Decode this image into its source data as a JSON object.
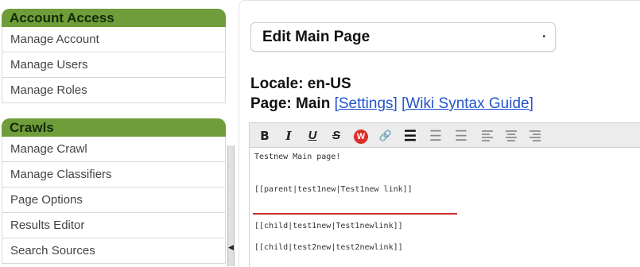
{
  "sidebar": {
    "sections": [
      {
        "title": "Account Access",
        "items": [
          "Manage Account",
          "Manage Users",
          "Manage Roles"
        ]
      },
      {
        "title": "Crawls",
        "items": [
          "Manage Crawl",
          "Manage Classifiers",
          "Page Options",
          "Results Editor",
          "Search Sources"
        ]
      }
    ]
  },
  "main": {
    "page_select": "Edit Main Page",
    "locale": "Locale: en-US",
    "page_label": "Page: Main",
    "settings_link": "[Settings]",
    "wiki_link": "[Wiki Syntax Guide]",
    "toolbar": {
      "bold": "B",
      "italic": "I",
      "underline": "U",
      "strike": "S",
      "wiki": "W",
      "link": "🔗",
      "bullets": "☰",
      "numbered": "☰",
      "indent": "☰"
    },
    "editor_lines": [
      "Testnew Main page!",
      "[[parent|test1new|Test1new link]]",
      "[[child|test1new|Test1newlink]]",
      "[[child|test2new|test2newlink]]"
    ]
  },
  "colors": {
    "section_header": "#6f9d3a",
    "link": "#2255cc",
    "annotation_underline": "#d12a2a",
    "wiki_icon": "#d9302a"
  }
}
